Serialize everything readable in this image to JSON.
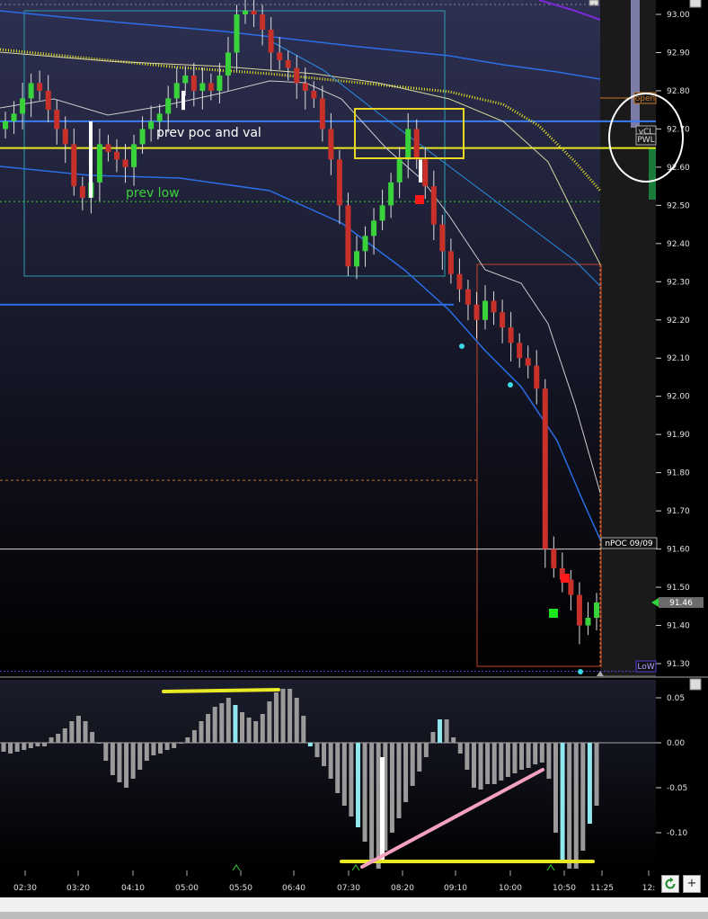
{
  "chart_data": [
    {
      "type": "candlestick",
      "title": "",
      "ylim": [
        91.27,
        93.03
      ],
      "y_ticks": [
        "93.00",
        "92.90",
        "92.80",
        "92.70",
        "92.60",
        "92.50",
        "92.40",
        "92.30",
        "92.20",
        "92.10",
        "92.00",
        "91.90",
        "91.80",
        "91.70",
        "91.60",
        "91.50",
        "91.40",
        "91.30"
      ],
      "x_ticks": [
        "02:30",
        "03:20",
        "04:10",
        "05:00",
        "05:50",
        "06:40",
        "07:30",
        "08:20",
        "09:10",
        "10:00",
        "10:50",
        "11:25",
        "12:"
      ],
      "last_price": "91.46",
      "annotations": [
        "prev poc and val",
        "prev low"
      ],
      "level_tags": [
        "open",
        "vCL",
        "PWL",
        "nPOC 09/09",
        "LoW"
      ],
      "levels": {
        "prev_poc": 92.72,
        "prev_val": 92.65,
        "prev_low": 92.51,
        "lower_blue": 92.24,
        "orange_dashed": 91.78,
        "npoc": 91.6,
        "low_week": 91.28
      },
      "candles_close": [
        92.72,
        92.74,
        92.78,
        92.82,
        92.8,
        92.75,
        92.7,
        92.66,
        92.55,
        92.52,
        92.56,
        92.66,
        92.64,
        92.62,
        92.6,
        92.66,
        92.7,
        92.72,
        92.74,
        92.78,
        92.82,
        92.84,
        92.8,
        92.82,
        92.8,
        92.84,
        92.9,
        93.0,
        93.01,
        93.0,
        92.96,
        92.9,
        92.88,
        92.86,
        92.82,
        92.8,
        92.78,
        92.7,
        92.62,
        92.5,
        92.34,
        92.38,
        92.42,
        92.46,
        92.5,
        92.56,
        92.62,
        92.7,
        92.62,
        92.55,
        92.45,
        92.38,
        92.32,
        92.28,
        92.24,
        92.2,
        92.25,
        92.22,
        92.18,
        92.14,
        92.1,
        92.08,
        92.02,
        91.6,
        91.55,
        91.52,
        91.48,
        91.4,
        91.42,
        91.46
      ],
      "markers": [
        {
          "kind": "red-square",
          "x": 467,
          "y": 222
        },
        {
          "kind": "red-square",
          "x": 629,
          "y": 643
        },
        {
          "kind": "green-square",
          "x": 616,
          "y": 682
        },
        {
          "kind": "cyan-dot",
          "x": 514,
          "y": 385
        },
        {
          "kind": "cyan-dot",
          "x": 568,
          "y": 428
        },
        {
          "kind": "cyan-dot",
          "x": 646,
          "y": 747
        }
      ]
    },
    {
      "type": "bar",
      "title": "",
      "ylim": [
        -0.155,
        0.075
      ],
      "y_ticks": [
        "0.05",
        "0.00",
        "-0.05",
        "-0.10"
      ],
      "values": [
        -0.01,
        -0.012,
        -0.01,
        -0.008,
        -0.006,
        -0.004,
        -0.004,
        0.006,
        0.01,
        0.016,
        0.024,
        0.03,
        0.024,
        0.012,
        0.0,
        -0.02,
        -0.036,
        -0.044,
        -0.05,
        -0.04,
        -0.03,
        -0.02,
        -0.014,
        -0.012,
        -0.008,
        -0.006,
        0.0,
        0.006,
        0.014,
        0.024,
        0.032,
        0.04,
        0.044,
        0.05,
        0.042,
        0.034,
        0.028,
        0.024,
        0.032,
        0.046,
        0.056,
        0.06,
        0.06,
        0.05,
        0.03,
        -0.004,
        -0.016,
        -0.026,
        -0.04,
        -0.056,
        -0.07,
        -0.082,
        -0.094,
        -0.11,
        -0.13,
        -0.14,
        -0.12,
        -0.1,
        -0.084,
        -0.066,
        -0.048,
        -0.032,
        -0.016,
        0.012,
        0.026,
        0.026,
        0.006,
        -0.012,
        -0.03,
        -0.05,
        -0.052,
        -0.046,
        -0.046,
        -0.042,
        -0.038,
        -0.034,
        -0.03,
        -0.028,
        -0.024,
        -0.022,
        -0.04,
        -0.1,
        -0.13,
        -0.14,
        -0.14,
        -0.12,
        -0.09,
        -0.07
      ]
    }
  ]
}
